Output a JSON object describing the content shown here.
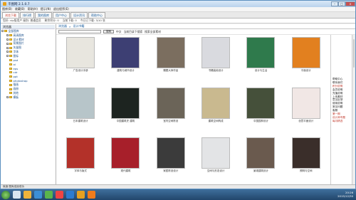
{
  "window": {
    "title": "千图网 2.1.0.7"
  },
  "menubar": [
    "图库(B)",
    "收藏(B)",
    "帮助(H)",
    "提示(N)",
    "退出程序(E)"
  ],
  "tabs": [
    {
      "label": "浏览下载",
      "active": true
    },
    {
      "label": "排行榜",
      "active": false
    },
    {
      "label": "我的图库",
      "active": false
    },
    {
      "label": "用户中心",
      "active": false
    },
    {
      "label": "设计资讯",
      "active": false
    },
    {
      "label": "帮助中心",
      "active": false
    }
  ],
  "statusline": [
    "您好: vip版用户 级别: 普通会员",
    "剩余积分: 0",
    "当前下载: 0",
    "今日已下载: 3/10 张"
  ],
  "tree": {
    "header": "浏览器",
    "nodes": [
      {
        "label": "全部图库",
        "level": 0,
        "expanded": true
      },
      {
        "label": "高清图库",
        "level": 1
      },
      {
        "label": "设计素材",
        "level": 1
      },
      {
        "label": "背景图片",
        "level": 1
      },
      {
        "label": "矢量图",
        "level": 1
      },
      {
        "label": "字体",
        "level": 1
      },
      {
        "label": "图标",
        "level": 1,
        "expanded": true
      },
      {
        "label": "psd",
        "level": 2
      },
      {
        "label": "ai",
        "level": 2
      },
      {
        "label": "eps",
        "level": 2
      },
      {
        "label": "cdr",
        "level": 2
      },
      {
        "label": "ppt",
        "level": 2
      },
      {
        "label": "photoshop",
        "level": 2
      },
      {
        "label": "插画",
        "level": 2
      },
      {
        "label": "画册",
        "level": 2
      },
      {
        "label": "其他",
        "level": 2
      },
      {
        "label": "模板",
        "level": 1
      }
    ]
  },
  "breadcrumb": [
    "浏览器",
    "设计书籍"
  ],
  "search": {
    "placeholder": "",
    "button_label": "搜索",
    "options": [
      "中文",
      "当前目录下搜索",
      "搜索全部素材"
    ]
  },
  "items": [
    {
      "caption": "广告设计手册",
      "color": "#e8e6df"
    },
    {
      "caption": "建筑与城市设计",
      "color": "#3d3f73"
    },
    {
      "caption": "雕塑大师作品",
      "color": "#7b6e5f"
    },
    {
      "caption": "书籍装帧设计",
      "color": "#d9dadf"
    },
    {
      "caption": "设计与生活",
      "color": "#2f7a4c"
    },
    {
      "caption": "平面设计",
      "color": "#e2801f"
    },
    {
      "caption": "日本建筑设计",
      "color": "#b7c5c9"
    },
    {
      "caption": "中国建筑史 建筑",
      "color": "#1d2420"
    },
    {
      "caption": "室内空间陈设",
      "color": "#6b6458"
    },
    {
      "caption": "建筑空间构成",
      "color": "#c9b98f"
    },
    {
      "caption": "中国园林设计",
      "color": "#45503a"
    },
    {
      "caption": "创意平面设计",
      "color": "#f1e7e5"
    },
    {
      "caption": "字体与版式",
      "color": "#b33129"
    },
    {
      "caption": "现代建筑",
      "color": "#a71f2a"
    },
    {
      "caption": "家居陈设设计",
      "color": "#3b3b3b"
    },
    {
      "caption": "空间与形态设计",
      "color": "#e3e4e6"
    },
    {
      "caption": "景观建筑设计",
      "color": "#6a5a4e"
    },
    {
      "caption": "照明与空间",
      "color": "#3a2e2a"
    }
  ],
  "rightpanel": [
    {
      "label": "帮助中心",
      "red": false
    },
    {
      "label": "联系我们",
      "red": false
    },
    {
      "label": "积分说明",
      "red": true
    },
    {
      "label": "会员说明",
      "red": false
    },
    {
      "label": "充值说明",
      "red": false
    },
    {
      "label": "上传素材",
      "red": false
    },
    {
      "label": "意见反馈",
      "red": false
    },
    {
      "label": "使用说明",
      "red": false
    },
    {
      "label": "常见问题",
      "red": false
    },
    {
      "label": "客服",
      "red": false
    },
    {
      "label": "第一期",
      "red": true
    },
    {
      "label": "设计师专题",
      "red": true
    },
    {
      "label": "每月精选",
      "red": true
    }
  ],
  "bottomstatus": "就绪  图库连接成功",
  "taskbar": {
    "icons": [
      "#d9e6f0",
      "#f0b43a",
      "#3c8fd6",
      "#5ab44c",
      "#e44",
      "#2c7bd0",
      "#e6a020",
      "#f07c1c"
    ],
    "clock_time": "20:26",
    "clock_date": "2015/12/30"
  }
}
